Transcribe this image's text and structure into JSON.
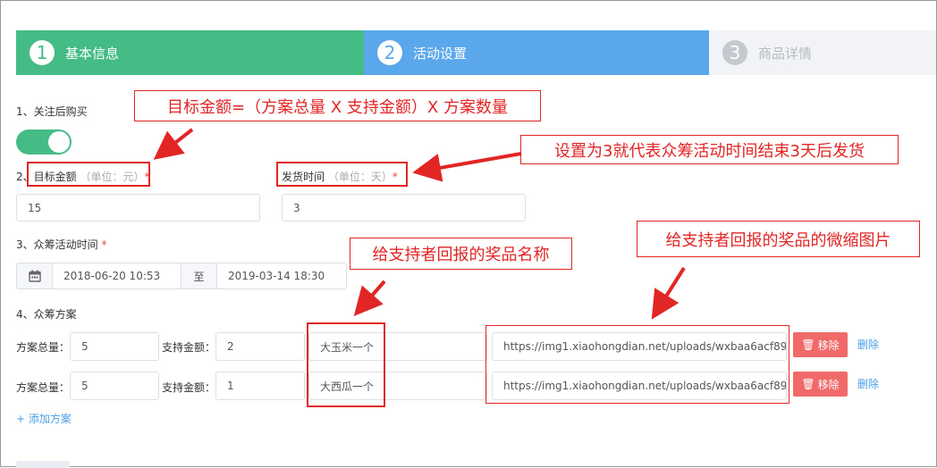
{
  "steps": [
    {
      "num": "1",
      "label": "基本信息",
      "state": "done"
    },
    {
      "num": "2",
      "label": "活动设置",
      "state": "active"
    },
    {
      "num": "3",
      "label": "商品详情",
      "state": "pending"
    }
  ],
  "follow": {
    "label": "1、关注后购买",
    "enabled": true
  },
  "target": {
    "prefix": "2、",
    "label": "目标金额",
    "hint": "（单位：元）",
    "required": "*",
    "value": "15"
  },
  "ship": {
    "label": "发货时间",
    "hint": "（单位：天）",
    "required": "*",
    "value": "3"
  },
  "period": {
    "label": "3、众筹活动时间",
    "required": "*",
    "start": "2018-06-20 10:53",
    "sep": "至",
    "end": "2019-03-14 18:30"
  },
  "plans_title": "4、众筹方案",
  "plans": [
    {
      "total_label": "方案总量：",
      "total": "5",
      "amount_label": "支持金额：",
      "amount": "2",
      "reward": "大玉米一个",
      "image_url": "https://img1.xiaohongdian.net/uploads/wxbaa6acf89684e55",
      "remove_label": "移除",
      "delete_label": "删除"
    },
    {
      "total_label": "方案总量：",
      "total": "5",
      "amount_label": "支持金额：",
      "amount": "1",
      "reward": "大西瓜一个",
      "image_url": "https://img1.xiaohongdian.net/uploads/wxbaa6acf89684e55",
      "remove_label": "移除",
      "delete_label": "删除"
    }
  ],
  "add_plan": "+ 添加方案",
  "annotations": {
    "formula": "目标金额=（方案总量 X 支持金额）X 方案数量",
    "ship_note": "设置为3就代表众筹活动时间结束3天后发货",
    "reward_note": "给支持者回报的奖品名称",
    "image_note": "给支持者回报的奖品的微缩图片"
  },
  "icons": {
    "calendar": "calendar-icon",
    "trash": "trash-icon"
  },
  "colors": {
    "green": "#45bc86",
    "blue": "#5aa7ec",
    "red": "#e22525",
    "remove": "#f06a6a",
    "link": "#4a9ee7"
  }
}
